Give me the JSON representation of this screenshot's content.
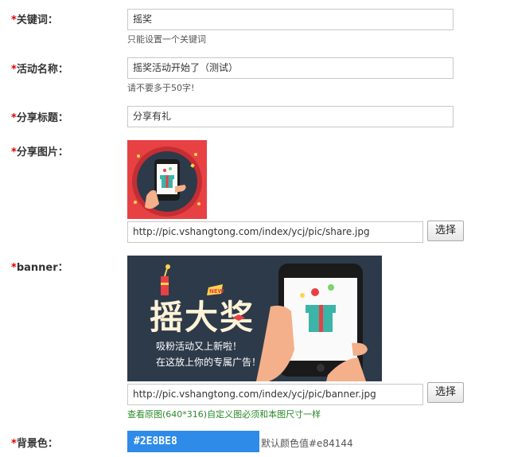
{
  "form": {
    "required_mark": "*",
    "keyword": {
      "label": "关键词：",
      "value": "摇奖",
      "hint": "只能设置一个关键词"
    },
    "activity_name": {
      "label": "活动名称：",
      "value": "摇奖活动开始了（测试）",
      "hint": "请不要多于50字!"
    },
    "share_title": {
      "label": "分享标题：",
      "value": "分享有礼"
    },
    "share_image": {
      "label": "分享图片：",
      "url": "http://pic.vshangtong.com/index/ycj/pic/share.jpg",
      "button": "选择"
    },
    "banner": {
      "label": "banner：",
      "url": "http://pic.vshangtong.com/index/ycj/pic/banner.jpg",
      "button": "选择",
      "hint": "查看原图(640*316)自定义图必须和本图尺寸一样",
      "image_text": {
        "title": "摇大奖",
        "line1": "吸粉活动又上新啦！",
        "line2": "在这放上你的专属广告！",
        "badge": "NEW"
      }
    },
    "bg_color": {
      "label": "背景色：",
      "value": "#2E8BE8",
      "default_note": "默认颜色值#e84144"
    }
  },
  "colors": {
    "required": "#dd0000",
    "swatch": "#2E8BE8",
    "share_bg": "#e84144",
    "banner_bg": "#2d3a4a"
  }
}
